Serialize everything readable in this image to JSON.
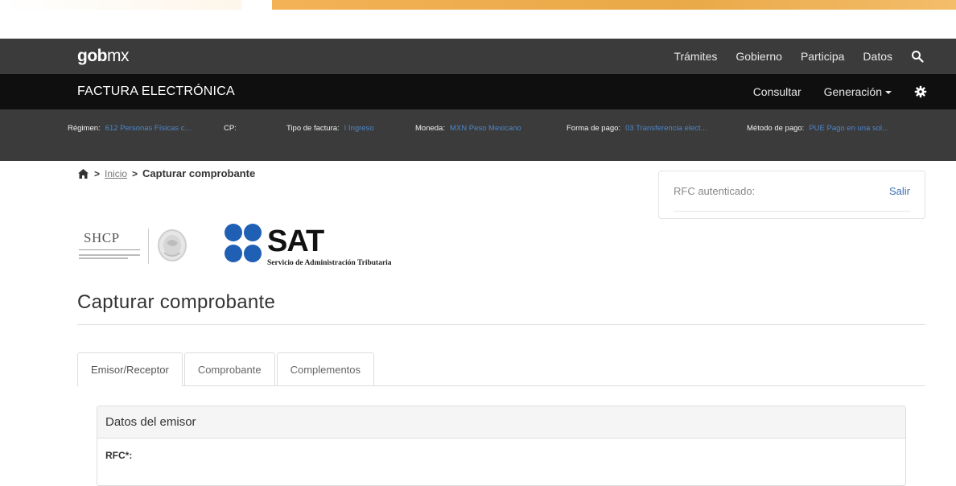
{
  "navbar": {
    "brand_left": "gob",
    "brand_right": "mx",
    "links": [
      "Trámites",
      "Gobierno",
      "Participa",
      "Datos"
    ],
    "search_icon": "search-icon"
  },
  "subnav": {
    "title": "FACTURA ELECTRÓNICA",
    "consultar": "Consultar",
    "generacion": "Generación",
    "settings_icon": "gear-icon"
  },
  "infobar": {
    "regimen_label": "Régimen:",
    "regimen_value": "612 Personas Físicas c...",
    "cp_label": "CP:",
    "cp_value": "",
    "tipo_label": "Tipo de factura:",
    "tipo_value": "I Ingreso",
    "moneda_label": "Moneda:",
    "moneda_value": "MXN Peso Mexicano",
    "forma_label": "Forma de pago:",
    "forma_value": "03 Transferencia elect...",
    "metodo_label": "Método de pago:",
    "metodo_value": "PUE Pago en una sol..."
  },
  "breadcrumb": {
    "home_icon": "home-icon",
    "inicio": "Inicio",
    "current": "Capturar comprobante"
  },
  "rfc": {
    "label": "RFC autenticado:",
    "logout": "Salir"
  },
  "logos": {
    "shcp": "SHCP",
    "sat": "SAT",
    "sat_sub": "Servicio de Administración Tributaria"
  },
  "page": {
    "title": "Capturar comprobante"
  },
  "tabs": [
    {
      "label": "Emisor/Receptor",
      "active": true
    },
    {
      "label": "Comprobante",
      "active": false
    },
    {
      "label": "Complementos",
      "active": false
    }
  ],
  "emisor": {
    "heading": "Datos del emisor",
    "rfc_label": "RFC*:"
  },
  "colors": {
    "navbar": "#3b3b3b",
    "subnav": "#0f0f0f",
    "link": "#3b73b9",
    "banner": "#e9a948"
  }
}
